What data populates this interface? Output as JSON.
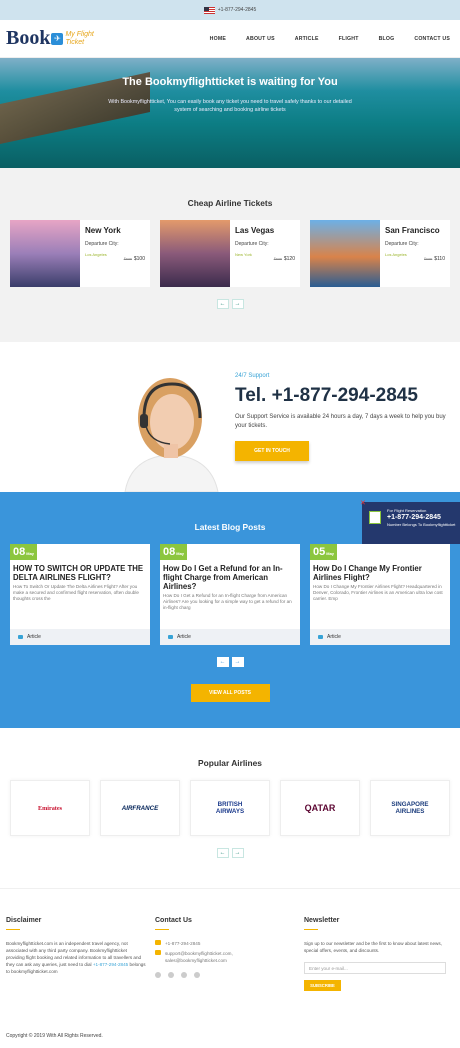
{
  "topbar": {
    "phone": "+1-877-294-2845"
  },
  "logo": {
    "book": "Book",
    "badge": "✈",
    "line1": "My Flight",
    "line2": "Ticket"
  },
  "nav": [
    "HOME",
    "ABOUT US",
    "ARTICLE",
    "FLIGHT",
    "BLOG",
    "CONTACT US"
  ],
  "hero": {
    "title": "The Bookmyflightticket is waiting for You",
    "text": "With Bookmyflightticket, You can easily book any ticket you need to travel safely thanks to our detailed system of searching and booking airline tickets"
  },
  "tickets": {
    "title": "Cheap Airline Tickets",
    "cards": [
      {
        "city": "New York",
        "label": "Departure City:",
        "from": "Los Angeles",
        "old": "From",
        "price": "$100"
      },
      {
        "city": "Las Vegas",
        "label": "Departure City:",
        "from": "New York",
        "old": "From",
        "price": "$120"
      },
      {
        "city": "San Francisco",
        "label": "Departure City:",
        "from": "Los Angeles",
        "old": "From",
        "price": "$110"
      }
    ]
  },
  "support": {
    "label": "24/7 Support",
    "tel": "Tel. +1-877-294-2845",
    "desc": "Our Support Service is available 24 hours a day, 7 days a week to help you buy your tickets.",
    "button": "GET IN TOUCH"
  },
  "blog": {
    "title": "Latest Blog Posts",
    "posts": [
      {
        "day": "08",
        "mon": "May",
        "title": "HOW TO SWITCH OR UPDATE THE DELTA AIRLINES FLIGHT?",
        "text": "How To Switch Or Update The Delta Airlines Flight? After you make a secured and confirmed flight reservation, often double thoughts cross the",
        "tag": "Article"
      },
      {
        "day": "08",
        "mon": "May",
        "title": "How Do I Get a Refund for an In-flight Charge from American Airlines?",
        "text": "How Do I Get a Refund for an In-flight Charge from American Airlines? Are you looking for a simple way to get a refund for an in-flight charg",
        "tag": "Article"
      },
      {
        "day": "05",
        "mon": "May",
        "title": "How Do I Change My Frontier Airlines Flight?",
        "text": "How Do I Change My Frontier Airlines Flight? Headquartered in Denver, Colorado, Frontier Airlines is an American ultra low cost carrier. Emp",
        "tag": "Article"
      }
    ],
    "button": "VIEW ALL POSTS"
  },
  "floatbox": {
    "a": "For Flight Reservation",
    "b": "+1-877-294-2845",
    "c": "Number Belongs To Bookmyflightticket"
  },
  "airlines": {
    "title": "Popular Airlines",
    "items": [
      {
        "name": "Emirates",
        "color": "#c8102e"
      },
      {
        "name": "AIRFRANCE",
        "color": "#002157"
      },
      {
        "name": "BRITISH AIRWAYS",
        "color": "#1b3a8c"
      },
      {
        "name": "QATAR",
        "color": "#5c0632"
      },
      {
        "name": "SINGAPORE AIRLINES",
        "color": "#f0a500"
      }
    ]
  },
  "footer": {
    "disclaimer": {
      "title": "Disclaimer",
      "text": "Bookmyflightticket.com is an independent travel agency, not associated with any third party company. Bookmyflightticket providing flight booking and related information to all travellers and they can ask any queries, just need to dial",
      "phone": "+1-877-294-2845",
      "tail": "belongs to bookmyflightticket.com"
    },
    "contact": {
      "title": "Contact Us",
      "phone": "+1-877-294-2845",
      "email": "support@bookmyflightticket.com, sales@bookmyflightticket.com"
    },
    "newsletter": {
      "title": "Newsletter",
      "text": "Sign up to our newsletter and be the first to know about latest news, special offers, events, and discounts.",
      "placeholder": "Enter your e-mail...",
      "button": "SUBSCRIBE"
    }
  },
  "copyright": "Copyright © 2019 With All Rights Reserved."
}
